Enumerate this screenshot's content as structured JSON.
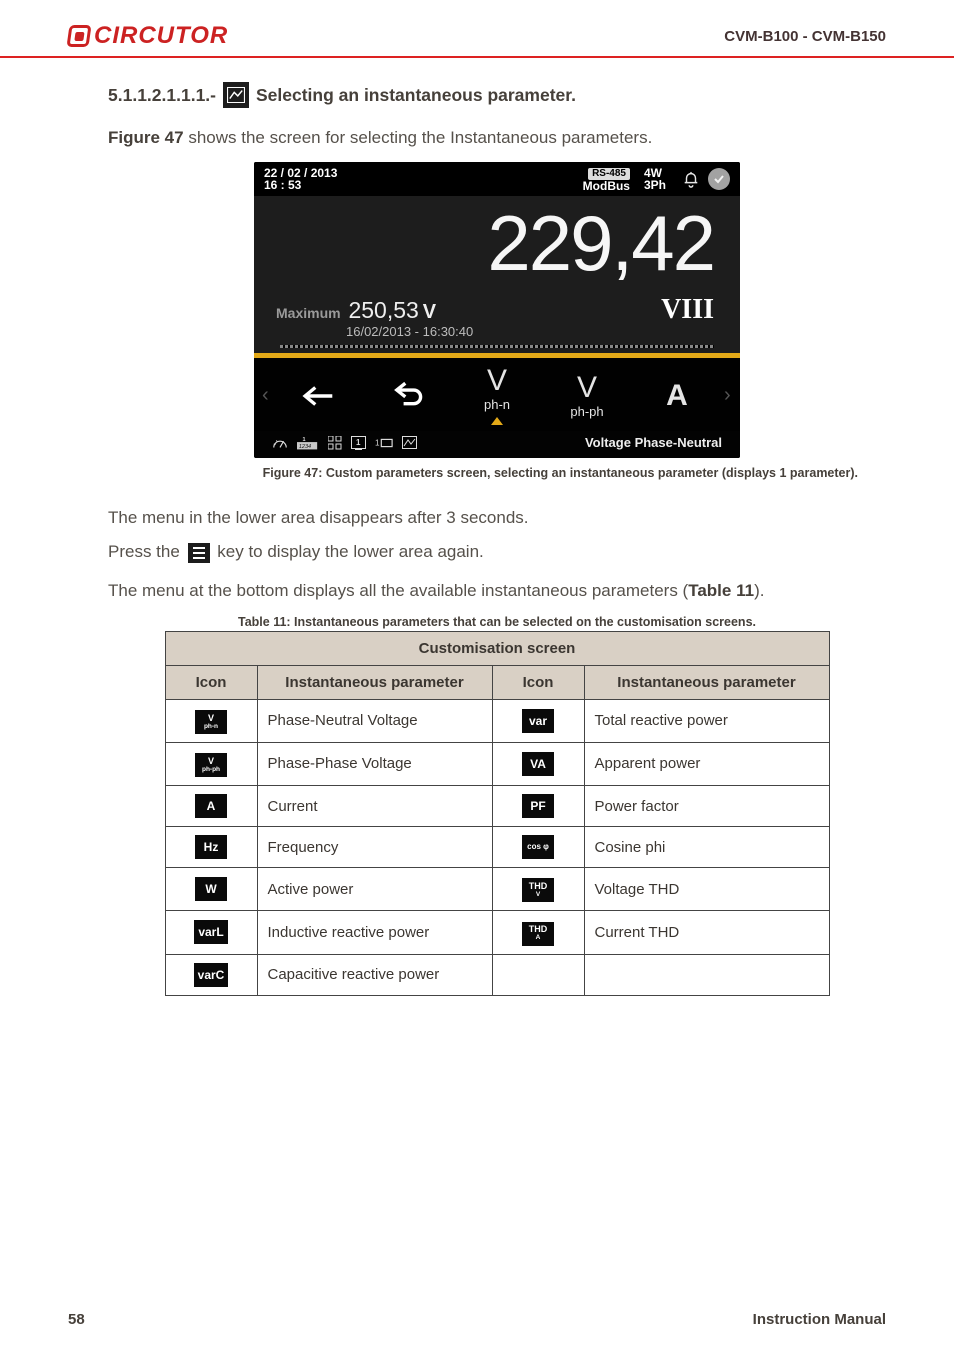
{
  "header": {
    "brand": "CIRCUTOR",
    "model": "CVM-B100 - CVM-B150"
  },
  "section": {
    "num": "5.1.1.2.1.1.1.-",
    "title": " Selecting an instantaneous parameter."
  },
  "intro": {
    "pre": "Figure 47",
    "rest": " shows the screen for selecting the Instantaneous parameters."
  },
  "device": {
    "topbar": {
      "date": "22 / 02 / 2013",
      "time": "16 : 53",
      "rs": "RS-485",
      "modbus": "ModBus",
      "w4": "4W",
      "ph3": "3Ph"
    },
    "main_value": "229,42",
    "max_label": "Maximum",
    "max_value": "250,53",
    "max_unit": "V",
    "max_ts": "16/02/2013 - 16:30:40",
    "roman": "VIII",
    "menu": {
      "vphn_big": "V",
      "vphn_sm": "ph-n",
      "vphph_big": "V",
      "vphph_sm": "ph-ph",
      "a_big": "A"
    },
    "footer_label": "Voltage Phase-Neutral"
  },
  "fig_caption": "Figure 47: Custom parameters screen, selecting an instantaneous parameter (displays 1 parameter).",
  "note1": "The menu in the lower area disappears after 3 seconds.",
  "note2_a": "Press the ",
  "note2_b": " key to display the lower area again.",
  "menu_line_a": "The menu at the bottom displays all the available instantaneous parameters (",
  "menu_line_b": "Table 11",
  "menu_line_c": ").",
  "table_caption": "Table 11: Instantaneous parameters that can be selected on the customisation screens.",
  "table": {
    "title": "Customisation screen",
    "h_icon": "Icon",
    "h_param": "Instantaneous parameter",
    "rows": [
      {
        "i1_l1": "V",
        "i1_l2": "ph-n",
        "p1": "Phase-Neutral Voltage",
        "i2_l1": "var",
        "i2_l2": "",
        "p2": "Total reactive power"
      },
      {
        "i1_l1": "V",
        "i1_l2": "ph-ph",
        "p1": "Phase-Phase Voltage",
        "i2_l1": "VA",
        "i2_l2": "",
        "p2": "Apparent power"
      },
      {
        "i1_l1": "A",
        "i1_l2": "",
        "p1": "Current",
        "i2_l1": "PF",
        "i2_l2": "",
        "p2": "Power factor"
      },
      {
        "i1_l1": "Hz",
        "i1_l2": "",
        "p1": "Frequency",
        "i2_l1": "cos φ",
        "i2_l2": "",
        "p2": "Cosine phi"
      },
      {
        "i1_l1": "W",
        "i1_l2": "",
        "p1": "Active power",
        "i2_l1": "THD",
        "i2_l2": "V",
        "p2": "Voltage THD"
      },
      {
        "i1_l1": "varL",
        "i1_l2": "",
        "p1": "Inductive reactive power",
        "i2_l1": "THD",
        "i2_l2": "A",
        "p2": "Current THD"
      },
      {
        "i1_l1": "varC",
        "i1_l2": "",
        "p1": "Capacitive reactive power",
        "i2_l1": "",
        "i2_l2": "",
        "p2": ""
      }
    ]
  },
  "footer": {
    "page": "58",
    "manual": "Instruction Manual"
  }
}
